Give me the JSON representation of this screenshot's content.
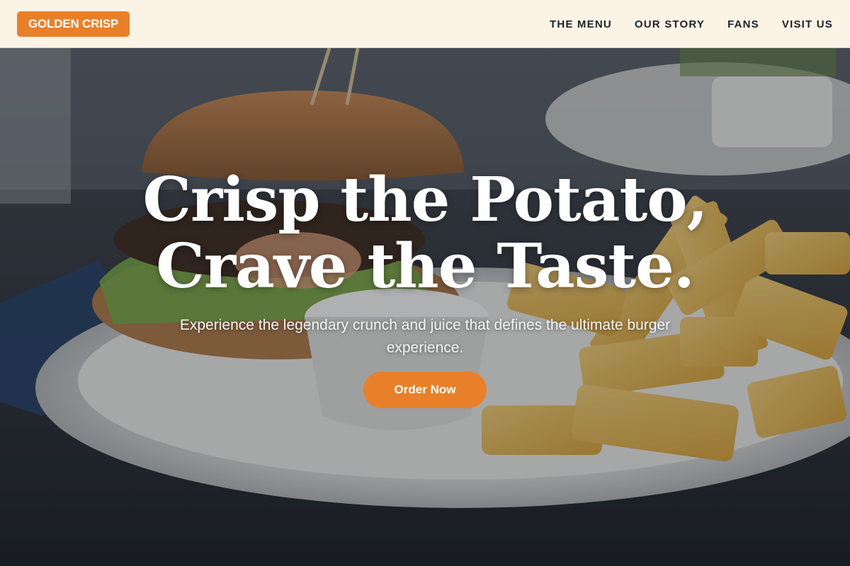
{
  "header": {
    "logo": "GOLDEN CRISP",
    "nav": [
      "THE MENU",
      "OUR STORY",
      "FANS",
      "VISIT US"
    ]
  },
  "hero": {
    "headline_line1": "Crisp the Potato,",
    "headline_line2": "Crave the Taste.",
    "subtitle": "Experience the legendary crunch and juice that defines the ultimate burger experience.",
    "cta_label": "Order Now"
  },
  "colors": {
    "accent": "#e8802a",
    "header_bg": "#fbf3e6",
    "text_dark": "#222222"
  }
}
